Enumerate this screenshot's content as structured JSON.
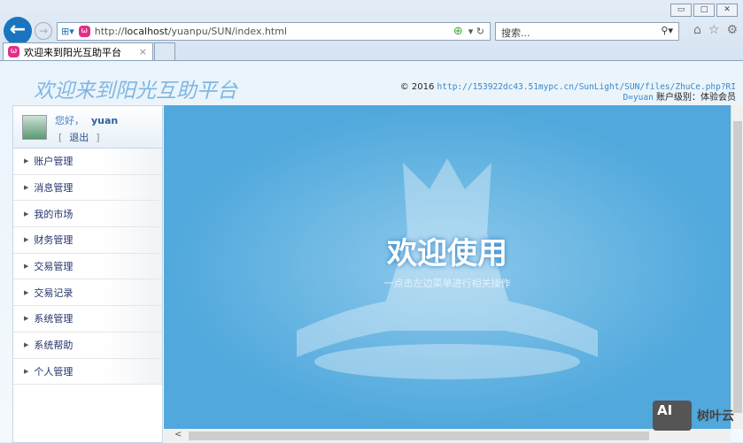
{
  "browser": {
    "url_prefix": "http://",
    "url_host": "localhost",
    "url_path": "/yuanpu/SUN/index.html",
    "search_placeholder": "搜索...",
    "tab_title": "欢迎来到阳光互助平台",
    "tab_close": "×"
  },
  "header": {
    "logo": "欢迎来到阳光互助平台",
    "copyright": "© 2016",
    "link": "http://153922dc43.51mypc.cn/SunLight/SUN/files/ZhuCe.php?RID=yuan",
    "level_label": "账户级别：",
    "level_value": "体验会员"
  },
  "user": {
    "greeting": "您好，",
    "name": "yuan",
    "logout_open": "[",
    "logout": "退出",
    "logout_close": "]"
  },
  "menu": [
    "账户管理",
    "消息管理",
    "我的市场",
    "财务管理",
    "交易管理",
    "交易记录",
    "系统管理",
    "系统帮助",
    "个人管理"
  ],
  "main": {
    "title": "欢迎使用",
    "subtitle": "一点击左边菜单进行相关操作"
  },
  "watermark": {
    "logo": "AI",
    "text": "树叶云"
  }
}
